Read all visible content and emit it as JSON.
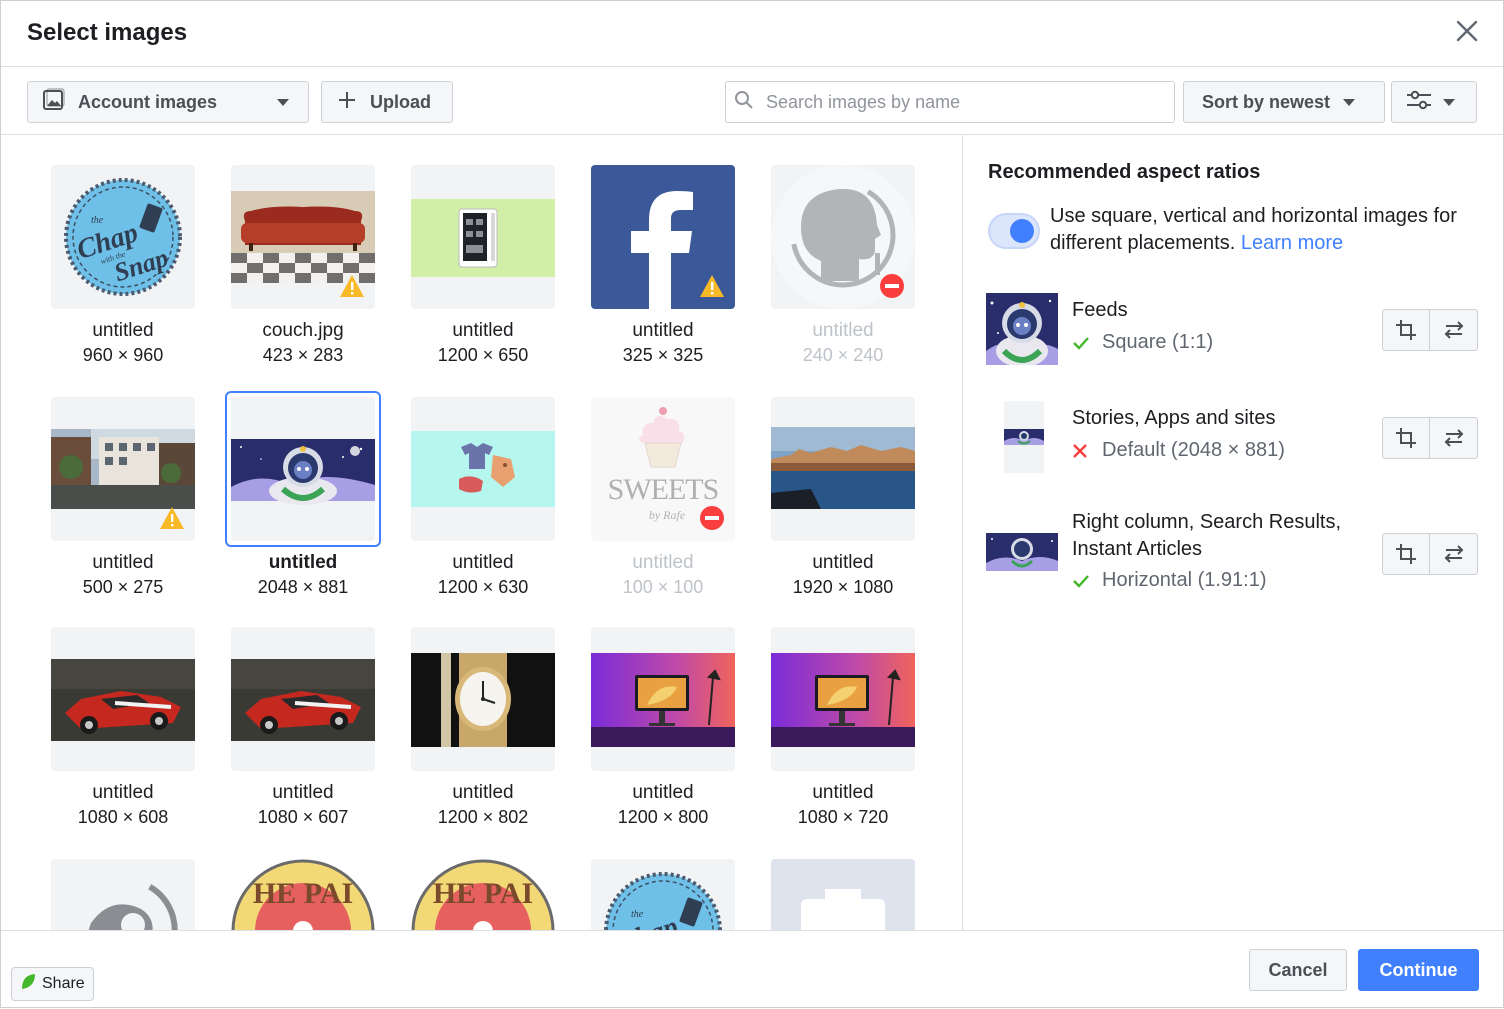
{
  "dialog": {
    "title": "Select images"
  },
  "toolbar": {
    "source_label": "Account images",
    "upload_label": "Upload",
    "search_placeholder": "Search images by name",
    "sort_label": "Sort by newest"
  },
  "images": [
    {
      "name": "untitled",
      "dims": "960 × 960",
      "art": "chap-logo",
      "badge": "none",
      "state": "normal"
    },
    {
      "name": "couch.jpg",
      "dims": "423 × 283",
      "art": "couch",
      "badge": "warning",
      "state": "normal"
    },
    {
      "name": "untitled",
      "dims": "1200 × 650",
      "art": "device-green",
      "badge": "none",
      "state": "normal"
    },
    {
      "name": "untitled",
      "dims": "325 × 325",
      "art": "facebook-f",
      "badge": "warning",
      "state": "normal"
    },
    {
      "name": "untitled",
      "dims": "240 × 240",
      "art": "head-silhouette",
      "badge": "blocked",
      "state": "disabled"
    },
    {
      "name": "untitled",
      "dims": "500 × 275",
      "art": "street-photo",
      "badge": "warning",
      "state": "normal"
    },
    {
      "name": "untitled",
      "dims": "2048 × 881",
      "art": "astronaut-banner",
      "badge": "none",
      "state": "selected"
    },
    {
      "name": "untitled",
      "dims": "1200 × 630",
      "art": "clothes-cyan",
      "badge": "none",
      "state": "normal"
    },
    {
      "name": "untitled",
      "dims": "100 × 100",
      "art": "sweets-cupcake",
      "badge": "blocked",
      "state": "disabled"
    },
    {
      "name": "untitled",
      "dims": "1920 × 1080",
      "art": "river-city",
      "badge": "none",
      "state": "normal"
    },
    {
      "name": "untitled",
      "dims": "1080 × 608",
      "art": "toy-car",
      "badge": "none",
      "state": "normal"
    },
    {
      "name": "untitled",
      "dims": "1080 × 607",
      "art": "toy-car",
      "badge": "none",
      "state": "normal"
    },
    {
      "name": "untitled",
      "dims": "1200 × 802",
      "art": "watch",
      "badge": "none",
      "state": "normal"
    },
    {
      "name": "untitled",
      "dims": "1200 × 800",
      "art": "desk-neon",
      "badge": "none",
      "state": "normal"
    },
    {
      "name": "untitled",
      "dims": "1080 × 720",
      "art": "desk-neon",
      "badge": "none",
      "state": "normal"
    },
    {
      "name": "",
      "dims": "",
      "art": "head-partial",
      "badge": "none",
      "state": "normal"
    },
    {
      "name": "",
      "dims": "",
      "art": "hepai-logo",
      "badge": "none",
      "state": "normal"
    },
    {
      "name": "",
      "dims": "",
      "art": "hepai-logo",
      "badge": "none",
      "state": "normal"
    },
    {
      "name": "",
      "dims": "",
      "art": "chap-logo",
      "badge": "none",
      "state": "normal"
    },
    {
      "name": "",
      "dims": "",
      "art": "camera-placeholder",
      "badge": "none",
      "state": "normal"
    }
  ],
  "hepai_text": "HE PAI",
  "chap_text": [
    "the",
    "Chap",
    "with the",
    "Snap"
  ],
  "sweets_text": [
    "SWEETS",
    "by Rafe"
  ],
  "aspect": {
    "title": "Recommended aspect ratios",
    "toggle_on": true,
    "description": "Use square, vertical and horizontal images for different placements.",
    "learn_more": "Learn more",
    "placements": [
      {
        "label": "Feeds",
        "status": "Square (1:1)",
        "ok": true,
        "thumb": "square"
      },
      {
        "label": "Stories, Apps and sites",
        "status": "Default (2048 × 881)",
        "ok": false,
        "thumb": "vertical"
      },
      {
        "label": "Right column, Search Results, Instant Articles",
        "status": "Horizontal (1.91:1)",
        "ok": true,
        "thumb": "horizontal"
      }
    ]
  },
  "footer": {
    "cancel_label": "Cancel",
    "continue_label": "Continue",
    "share_label": "Share"
  },
  "colors": {
    "accent": "#4080ff",
    "ok": "#42b72a",
    "error": "#fa3e3e",
    "warning": "#f7b928"
  }
}
